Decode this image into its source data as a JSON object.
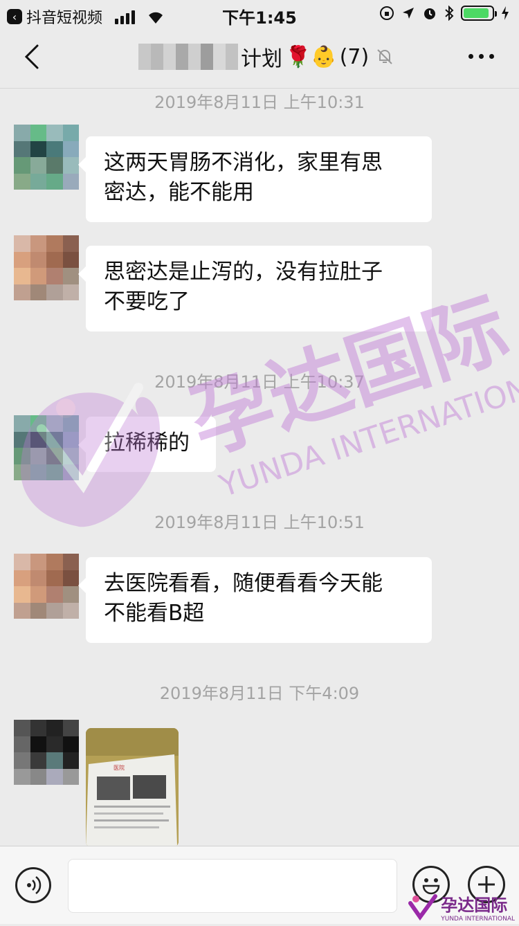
{
  "status_bar": {
    "back_app_label": "抖音短视频",
    "time": "下午1:45",
    "battery_level": 0.9
  },
  "nav": {
    "title": "计划",
    "title_emoji": "🌹👶",
    "member_count": "(7)"
  },
  "messages": [
    {
      "timestamp": "2019年8月11日 上午10:31",
      "text": "这两天胃肠不消化，家里有思\n密达，能不能用"
    },
    {
      "text": "思密达是止泻的，没有拉肚子\n不要吃了"
    },
    {
      "timestamp": "2019年8月11日 上午10:37",
      "text": "拉稀稀的"
    },
    {
      "timestamp": "2019年8月11日 上午10:51",
      "text": "去医院看看，随便看看今天能\n不能看B超"
    },
    {
      "timestamp": "2019年8月11日 下午4:09",
      "type": "image"
    }
  ],
  "watermark": {
    "cn": "孕达国际",
    "en": "YUNDA INTERNATIONAL"
  },
  "input_bar": {
    "placeholder": ""
  },
  "corner_logo": {
    "cn": "孕达国际",
    "en": "YUNDA INTERNATIONAL"
  },
  "colors": {
    "background": "#ebebeb",
    "bubble": "#ffffff",
    "timestamp": "#a3a3a3",
    "watermark": "#c07ad6",
    "battery": "#4cd964"
  }
}
